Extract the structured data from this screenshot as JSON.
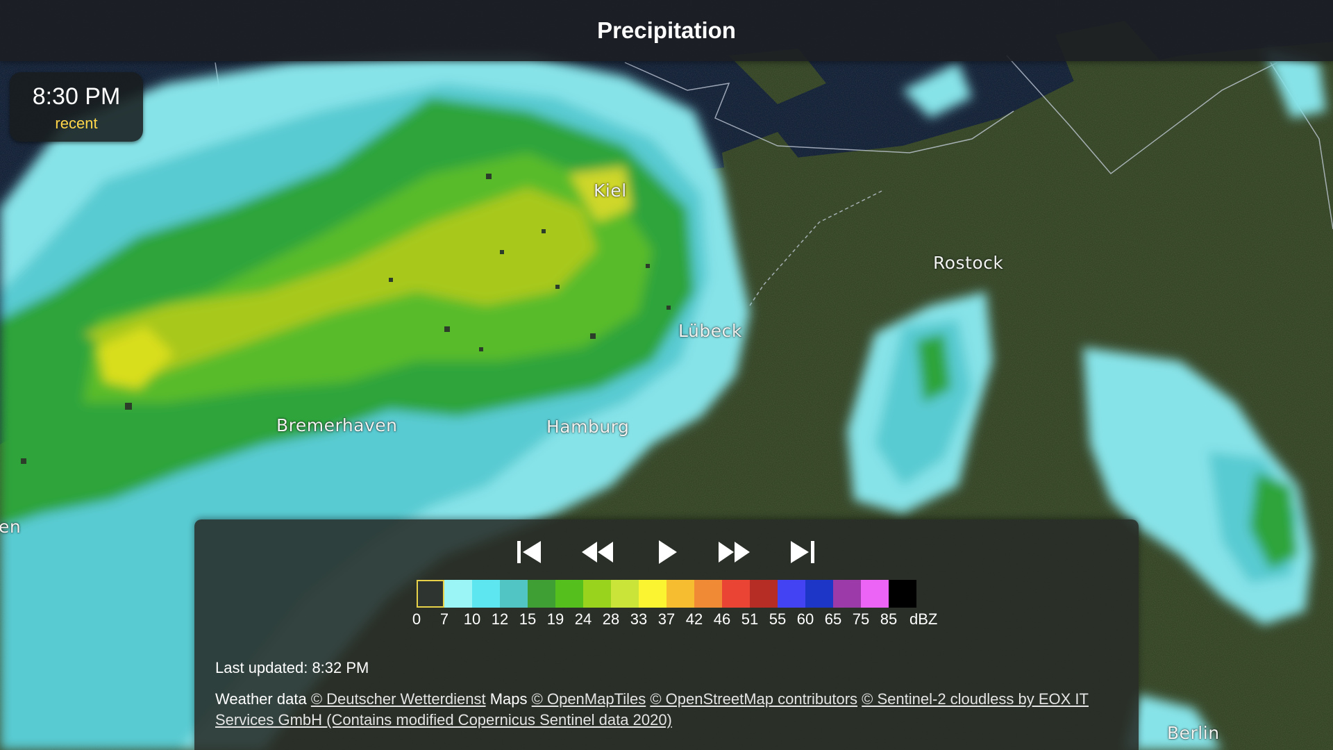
{
  "header": {
    "title": "Precipitation"
  },
  "time_display": {
    "time": "8:30 PM",
    "status": "recent"
  },
  "map": {
    "cities": [
      {
        "name": "Kiel",
        "id": "kiel"
      },
      {
        "name": "Rostock",
        "id": "rostock"
      },
      {
        "name": "Lübeck",
        "id": "luebeck"
      },
      {
        "name": "Bremerhaven",
        "id": "bremerhaven"
      },
      {
        "name": "Hamburg",
        "id": "hamburg"
      },
      {
        "name": "Berlin",
        "id": "berlin"
      },
      {
        "name": "en",
        "id": "partial-left-city"
      }
    ],
    "colors": {
      "sea": "#14233a",
      "land": "#3a4a2a",
      "rain_light": "#7fe0e6",
      "rain_mid": "#2fa43a",
      "rain_heavy": "#d6e21c"
    }
  },
  "controls": {
    "first_icon": "skip-to-start-icon",
    "rewind_icon": "rewind-icon",
    "play_icon": "play-icon",
    "fast_forward_icon": "fast-forward-icon",
    "last_icon": "skip-to-end-icon"
  },
  "legend": {
    "unit": "dBZ",
    "ticks": [
      "0",
      "7",
      "10",
      "12",
      "15",
      "19",
      "24",
      "28",
      "33",
      "37",
      "42",
      "46",
      "51",
      "55",
      "60",
      "65",
      "75",
      "85"
    ],
    "colors": [
      "#2e3430",
      "#9bf4f6",
      "#5de6f0",
      "#51c4c4",
      "#3f9f34",
      "#55bf1e",
      "#9ad31e",
      "#cae43a",
      "#fbf531",
      "#f6bd31",
      "#f08a34",
      "#ea4435",
      "#b52d24",
      "#4343f3",
      "#1e36c8",
      "#9b3aa8",
      "#ec64f5",
      "#000000"
    ]
  },
  "footer": {
    "last_updated": "Last updated: 8:32 PM",
    "weather_data_label": "Weather data",
    "dwd_link": "© Deutscher Wetterdienst",
    "maps_label": "Maps",
    "omt_link": "© OpenMapTiles",
    "osm_link": "© OpenStreetMap contributors",
    "sentinel_link": "© Sentinel-2 cloudless by EOX IT Services GmbH (Contains modified Copernicus Sentinel data 2020)"
  }
}
